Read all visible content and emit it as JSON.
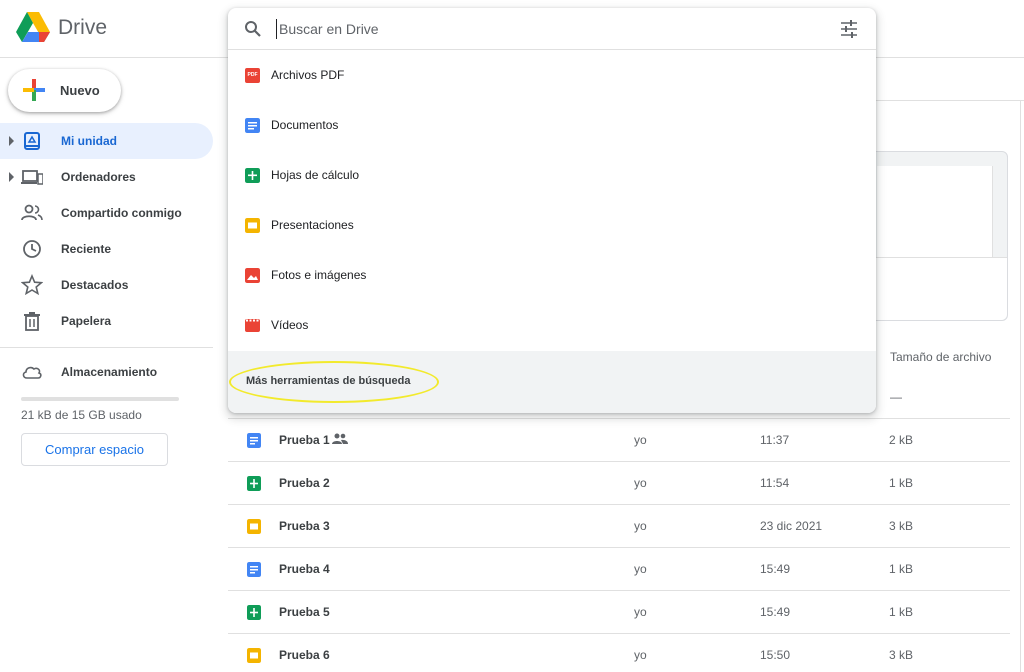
{
  "header": {
    "brand": "Drive"
  },
  "sidebar": {
    "new_label": "Nuevo",
    "items": [
      {
        "label": "Mi unidad",
        "icon": "my-drive-icon",
        "active": true
      },
      {
        "label": "Ordenadores",
        "icon": "computers-icon"
      },
      {
        "label": "Compartido conmigo",
        "icon": "shared-icon"
      },
      {
        "label": "Reciente",
        "icon": "clock-icon"
      },
      {
        "label": "Destacados",
        "icon": "star-icon"
      },
      {
        "label": "Papelera",
        "icon": "trash-icon"
      }
    ],
    "storage": {
      "label": "Almacenamiento",
      "used_text": "21 kB de 15 GB usado",
      "used_fraction": 1e-06,
      "buy_label": "Comprar espacio"
    }
  },
  "search": {
    "placeholder": "Buscar en Drive",
    "options": [
      {
        "label": "Archivos PDF",
        "icon": "pdf-icon",
        "icon_text": "PDF"
      },
      {
        "label": "Documentos",
        "icon": "document-icon"
      },
      {
        "label": "Hojas de cálculo",
        "icon": "spreadsheet-icon"
      },
      {
        "label": "Presentaciones",
        "icon": "presentation-icon"
      },
      {
        "label": "Fotos e imágenes",
        "icon": "image-icon"
      },
      {
        "label": "Vídeos",
        "icon": "video-icon"
      }
    ],
    "more_tools": "Más herramientas de búsqueda"
  },
  "file_list": {
    "size_header": "Tamaño de archivo",
    "first_row_size": "—",
    "rows": [
      {
        "name": "Prueba 1",
        "type": "doc",
        "shared": true,
        "owner": "yo",
        "modified": "11:37",
        "size": "2 kB"
      },
      {
        "name": "Prueba 2",
        "type": "sheet",
        "owner": "yo",
        "modified": "11:54",
        "size": "1 kB"
      },
      {
        "name": "Prueba 3",
        "type": "slide",
        "owner": "yo",
        "modified": "23 dic 2021",
        "size": "3 kB"
      },
      {
        "name": "Prueba 4",
        "type": "doc",
        "owner": "yo",
        "modified": "15:49",
        "size": "1 kB"
      },
      {
        "name": "Prueba 5",
        "type": "sheet",
        "owner": "yo",
        "modified": "15:49",
        "size": "1 kB"
      },
      {
        "name": "Prueba 6",
        "type": "slide",
        "owner": "yo",
        "modified": "15:50",
        "size": "3 kB"
      }
    ]
  },
  "colors": {
    "accent": "#1a73e8",
    "active_bg": "#e8f0fe",
    "highlight": "#f2ea2c"
  }
}
